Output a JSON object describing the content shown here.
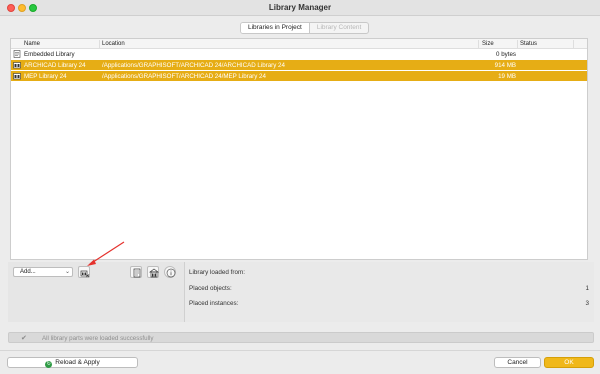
{
  "window": {
    "title": "Library Manager"
  },
  "tabs": [
    {
      "label": "Libraries in Project",
      "active": true
    },
    {
      "label": "Library Content",
      "active": false
    }
  ],
  "table": {
    "columns": [
      "Name",
      "Location",
      "Size",
      "Status"
    ],
    "rows": [
      {
        "name": "Embedded Library",
        "location": "",
        "size": "0 bytes",
        "status": "",
        "selected": false,
        "icon": "embedded-library-icon"
      },
      {
        "name": "ARCHICAD Library 24",
        "location": "/Applications/GRAPHISOFT/ARCHICAD 24/ARCHICAD Library 24",
        "size": "914 MB",
        "status": "",
        "selected": true,
        "icon": "library-folder-icon"
      },
      {
        "name": "MEP Library 24",
        "location": "/Applications/GRAPHISOFT/ARCHICAD 24/MEP Library 24",
        "size": "19 MB",
        "status": "",
        "selected": true,
        "icon": "library-folder-icon"
      }
    ]
  },
  "controls": {
    "add_label": "Add...",
    "toolbar_icons": [
      "remove-library-icon",
      "document-icon",
      "library-building-icon",
      "info-icon"
    ]
  },
  "info": {
    "loaded_from_label": "Library loaded from:",
    "placed_objects_label": "Placed objects:",
    "placed_objects_value": "1",
    "placed_instances_label": "Placed instances:",
    "placed_instances_value": "3"
  },
  "status": {
    "text": "All library parts were loaded successfully"
  },
  "footer": {
    "reload_label": "Reload & Apply",
    "cancel_label": "Cancel",
    "ok_label": "OK"
  },
  "colors": {
    "selection": "#e6ad15",
    "ok_button": "#f0b81a",
    "annotation_arrow": "#e5322d"
  }
}
